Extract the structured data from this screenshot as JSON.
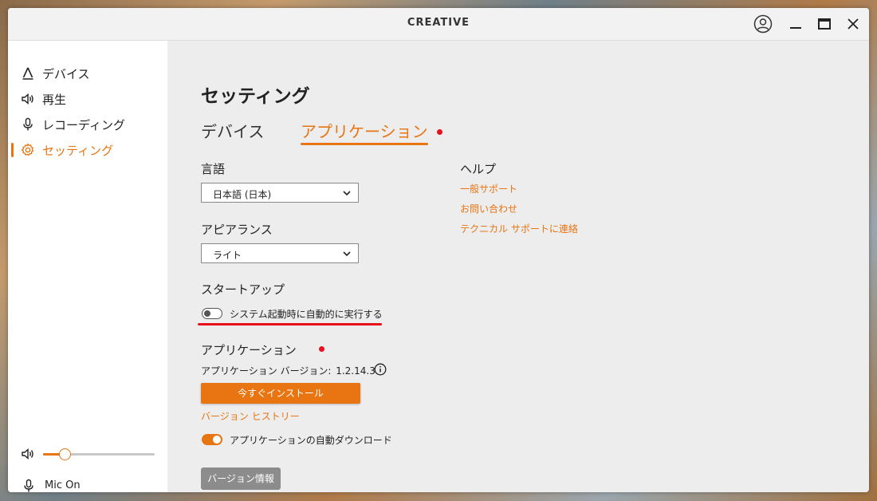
{
  "window": {
    "brand": "CREATIVE"
  },
  "sidebar": {
    "items": [
      {
        "label": "デバイス",
        "icon": "device-icon"
      },
      {
        "label": "再生",
        "icon": "speaker-icon"
      },
      {
        "label": "レコーディング",
        "icon": "microphone-icon"
      },
      {
        "label": "セッティング",
        "icon": "gear-icon",
        "active": true
      }
    ],
    "volume": {
      "level": 0.19,
      "icon": "speaker-icon"
    },
    "mic": {
      "label": "Mic On",
      "icon": "microphone-icon"
    }
  },
  "settings": {
    "title": "セッティング",
    "tabs": [
      {
        "label": "デバイス"
      },
      {
        "label": "アプリケーション",
        "active": true
      }
    ],
    "language": {
      "label": "言語",
      "value": "日本語 (日本)"
    },
    "appearance": {
      "label": "アピアランス",
      "value": "ライト"
    },
    "startup": {
      "label": "スタートアップ",
      "toggle_label": "システム起動時に自動的に実行する",
      "enabled": false
    },
    "application": {
      "label": "アプリケーション",
      "version_label": "アプリケーション バージョン:",
      "version": "1.2.14.3",
      "install_label": "今すぐインストール",
      "history_link": "バージョン ヒストリー",
      "auto_download_label": "アプリケーションの自動ダウンロード",
      "auto_download_enabled": true,
      "about_label": "バージョン情報"
    },
    "help": {
      "title": "ヘルプ",
      "links": [
        "一般サポート",
        "お問い合わせ",
        "テクニカル サポートに連絡"
      ]
    }
  },
  "colors": {
    "accent": "#e87511",
    "highlight": "#e8101c",
    "button_gray": "#8c8c8c"
  }
}
